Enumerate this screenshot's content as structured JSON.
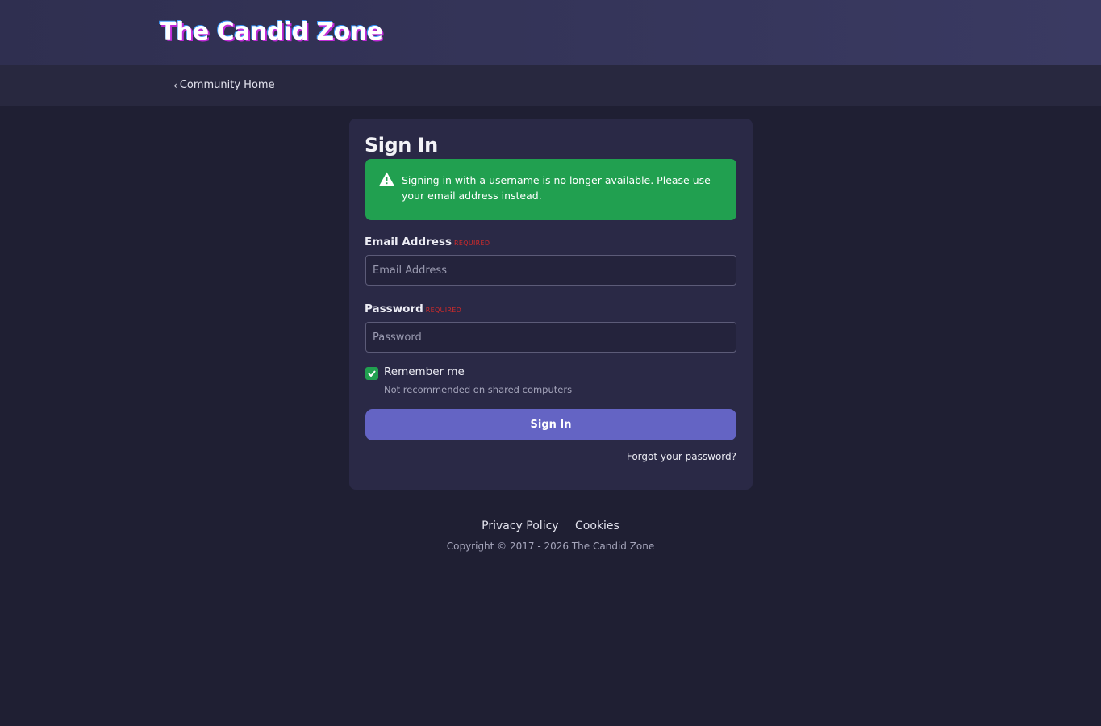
{
  "header": {
    "logo_text": "The Candid Zone"
  },
  "subnav": {
    "back_label": "Community Home"
  },
  "signin": {
    "title": "Sign In",
    "alert": "Signing in with a username is no longer available. Please use your email address instead.",
    "email": {
      "label": "Email Address",
      "required": "REQUIRED",
      "placeholder": "Email Address",
      "value": ""
    },
    "password": {
      "label": "Password",
      "required": "REQUIRED",
      "placeholder": "Password",
      "value": ""
    },
    "remember": {
      "label": "Remember me",
      "hint": "Not recommended on shared computers",
      "checked": true
    },
    "submit_label": "Sign In",
    "forgot_label": "Forgot your password?"
  },
  "footer": {
    "links": [
      "Privacy Policy",
      "Cookies"
    ],
    "copyright": "Copyright © 2017 - 2026 The Candid Zone"
  },
  "colors": {
    "background": "#1f1f33",
    "card": "#2a2946",
    "alert_green": "#21a050",
    "button_purple": "#6464c4",
    "required_red": "#d12a2a"
  },
  "icons": {
    "alert": "warning-triangle-icon",
    "back": "chevron-left-icon",
    "checkbox": "check-icon"
  }
}
